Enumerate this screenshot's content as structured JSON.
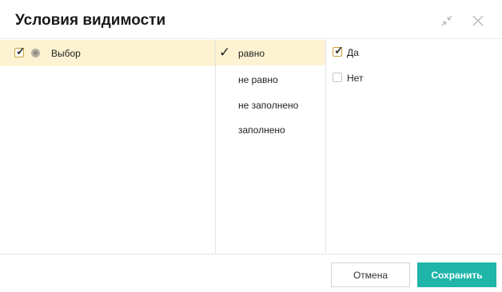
{
  "dialog": {
    "title": "Условия видимости",
    "header_icons": [
      "collapse-icon",
      "close-icon"
    ]
  },
  "fields": [
    {
      "label": "Выбор",
      "checked": true,
      "selected": true
    }
  ],
  "operators": [
    {
      "label": "равно",
      "selected": true
    },
    {
      "label": "не равно",
      "selected": false
    },
    {
      "label": "не заполнено",
      "selected": false
    },
    {
      "label": "заполнено",
      "selected": false
    }
  ],
  "values": [
    {
      "label": "Да",
      "checked": true
    },
    {
      "label": "Нет",
      "checked": false
    }
  ],
  "footer": {
    "cancel_label": "Отмена",
    "save_label": "Сохранить"
  },
  "colors": {
    "selection": "#fdf3d2",
    "primary": "#1fb5a8"
  }
}
